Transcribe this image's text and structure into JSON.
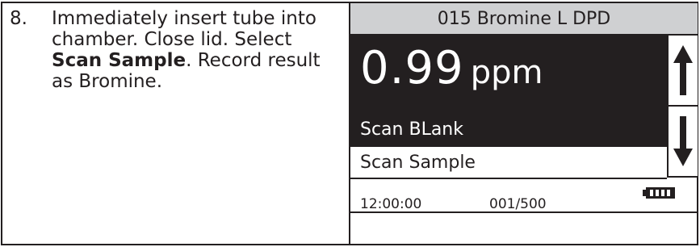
{
  "instruction": {
    "step_number": "8.",
    "text_before": "Immediately insert tube into chamber. Close lid. Select ",
    "bold_text": "Scan Sample",
    "text_after": ". Record result as Bromine."
  },
  "device": {
    "method_title": "015 Bromine L DPD",
    "reading_value": "0.99",
    "reading_unit": "ppm",
    "menu": {
      "scan_blank_label": "Scan BLank",
      "scan_sample_label": "Scan Sample"
    },
    "status": {
      "time": "12:00:00",
      "test_count": "001/500",
      "battery_icon": "battery-full-icon"
    },
    "scroll": {
      "up_icon": "arrow-up-icon",
      "down_icon": "arrow-down-icon"
    },
    "colors": {
      "panel_dark": "#231f20",
      "title_bar": "#cfd0d2"
    }
  }
}
